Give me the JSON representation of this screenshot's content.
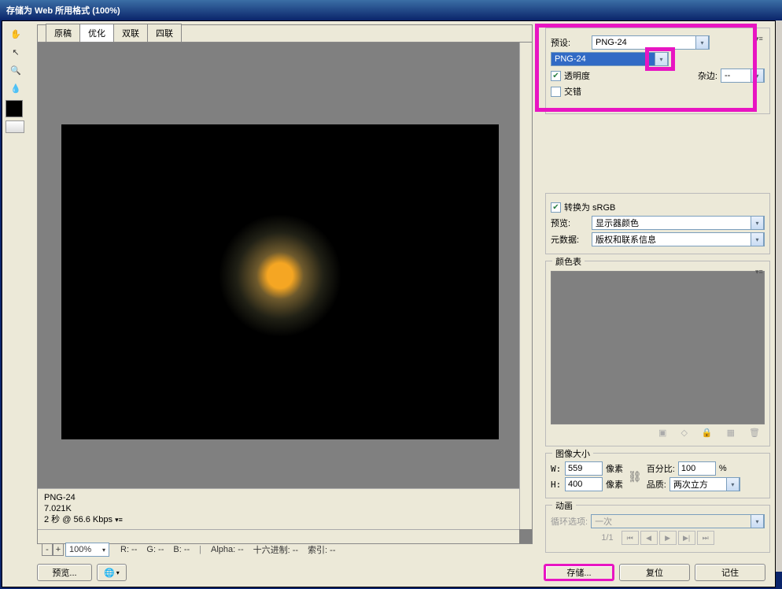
{
  "title": "存储为 Web 所用格式 (100%)",
  "tabs": [
    "原稿",
    "优化",
    "双联",
    "四联"
  ],
  "activeTab": 1,
  "preset": {
    "label": "预设:",
    "value": "PNG-24"
  },
  "format": {
    "value": "PNG-24"
  },
  "transparency": {
    "label": "透明度",
    "checked": true
  },
  "interlace": {
    "label": "交错",
    "checked": false
  },
  "matte": {
    "label": "杂边:",
    "value": "--"
  },
  "convertSrgb": {
    "label": "转换为 sRGB",
    "checked": true
  },
  "previewMode": {
    "label": "预览:",
    "value": "显示器颜色"
  },
  "metadata": {
    "label": "元数据:",
    "value": "版权和联系信息"
  },
  "colorTable": {
    "label": "颜色表"
  },
  "imageSize": {
    "label": "图像大小",
    "w": {
      "label": "W:",
      "value": "559",
      "unit": "像素"
    },
    "h": {
      "label": "H:",
      "value": "400",
      "unit": "像素"
    },
    "percent": {
      "label": "百分比:",
      "value": "100",
      "unit": "%"
    },
    "quality": {
      "label": "品质:",
      "value": "两次立方"
    }
  },
  "anim": {
    "label": "动画",
    "loopLabel": "循环选项:",
    "loopValue": "一次",
    "pos": "1/1"
  },
  "info": {
    "format": "PNG-24",
    "size": "7.021K",
    "time": "2 秒 @ 56.6 Kbps"
  },
  "zoom": "100%",
  "readout": {
    "r": "R: --",
    "g": "G: --",
    "b": "B: --",
    "alpha": "Alpha: --",
    "hex": "十六进制: --",
    "index": "索引: --"
  },
  "buttons": {
    "previewBtn": "预览...",
    "save": "存储...",
    "reset": "复位",
    "remember": "记住"
  }
}
